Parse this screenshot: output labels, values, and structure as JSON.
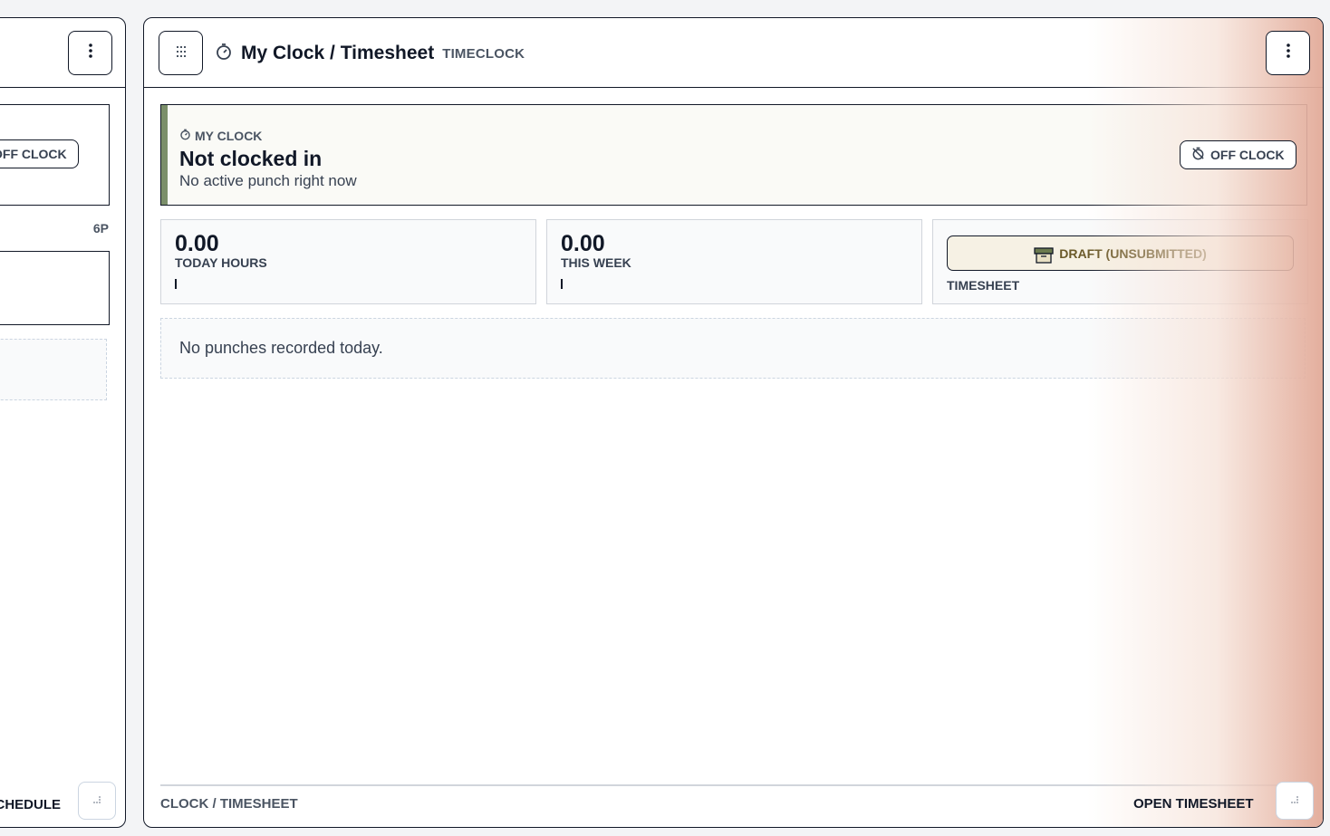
{
  "left_panel": {
    "menu_icon": "kebab-menu-icon",
    "status_pill": {
      "label": "OFF CLOCK",
      "icon": "clock-off-icon"
    },
    "hour_label": "6P",
    "footer_label": "CHEDULE",
    "resize_icon": "resize-grip-icon"
  },
  "main_panel": {
    "drag_icon": "drag-grid-icon",
    "title_icon": "stopwatch-icon",
    "title": "My Clock / Timesheet",
    "tag": "TIMECLOCK",
    "menu_icon": "kebab-menu-icon",
    "clock_card": {
      "kicker_icon": "stopwatch-icon",
      "kicker": "MY CLOCK",
      "title": "Not clocked in",
      "subtitle": "No active punch right now",
      "status_pill": {
        "label": "OFF CLOCK",
        "icon": "clock-off-icon"
      },
      "accent_color": "#7b8f6a"
    },
    "stats": [
      {
        "value": "0.00",
        "label": "TODAY HOURS"
      },
      {
        "value": "0.00",
        "label": "THIS WEEK"
      }
    ],
    "timesheet": {
      "badge_label": "DRAFT (UNSUBMITTED)",
      "badge_icon": "archive-icon",
      "label": "TIMESHEET",
      "badge_color": "#6b5a2a"
    },
    "empty_message": "No punches recorded today.",
    "footer": {
      "left_label": "CLOCK / TIMESHEET",
      "right_label": "OPEN TIMESHEET",
      "resize_icon": "resize-grip-icon"
    }
  }
}
